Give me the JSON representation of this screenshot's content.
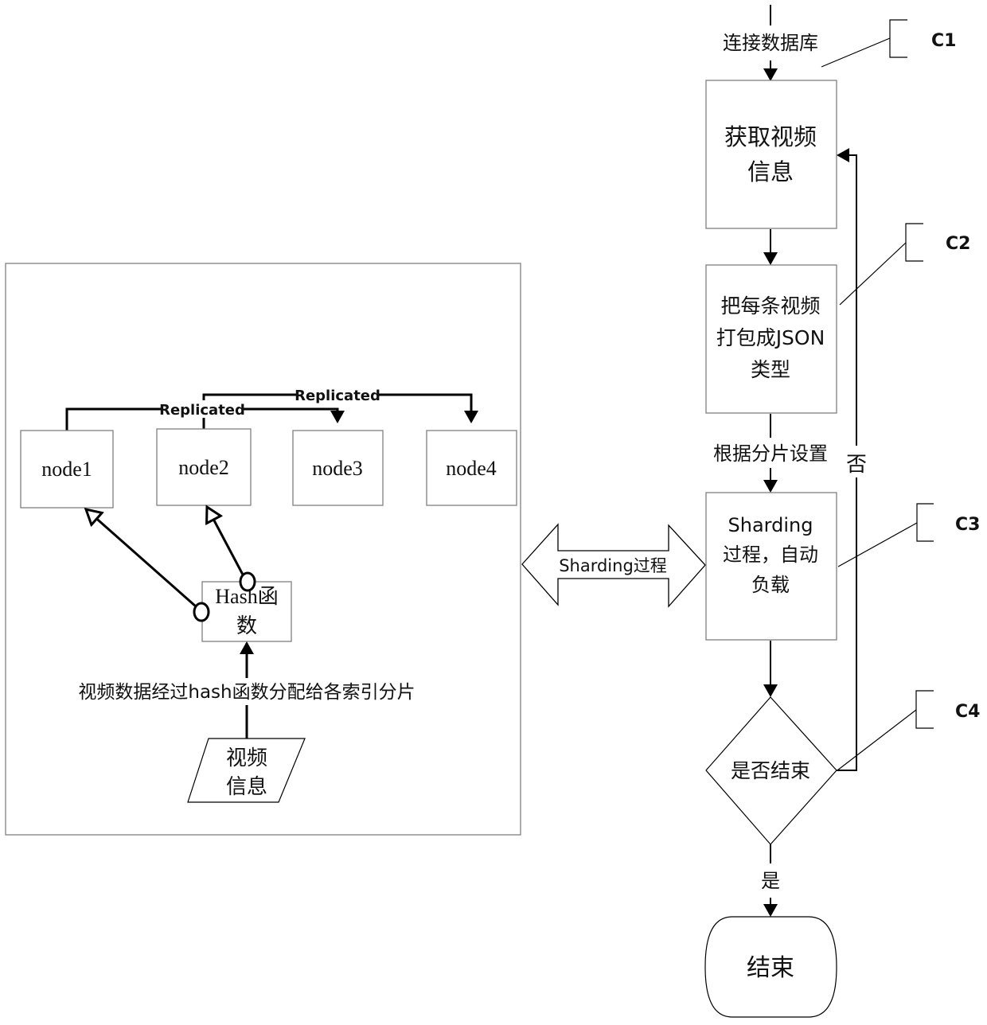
{
  "left_panel": {
    "nodes": [
      "node1",
      "node2",
      "node3",
      "node4"
    ],
    "replicated_labels": [
      "Replicated",
      "Replicated"
    ],
    "hash_box": {
      "line1": "Hash函",
      "line2": "数"
    },
    "distribution_label": "视频数据经过hash函数分配给各索引分片",
    "input": {
      "line1": "视频",
      "line2": "信息"
    }
  },
  "connector": {
    "label": "Sharding过程"
  },
  "flowchart": {
    "start_label": "连接数据库",
    "steps": [
      {
        "id": "C1",
        "lines": [
          "获取视频",
          "信息"
        ]
      },
      {
        "id": "C2",
        "lines": [
          "把每条视频",
          "打包成JSON",
          "类型"
        ]
      },
      {
        "id": "C3",
        "lines": [
          "Sharding",
          "过程，自动",
          "负载"
        ]
      }
    ],
    "shard_setting_label": "根据分片设置",
    "decision": {
      "id": "C4",
      "label": "是否结束"
    },
    "no_label": "否",
    "yes_label": "是",
    "end_label": "结束"
  },
  "callouts": [
    "C1",
    "C2",
    "C3",
    "C4"
  ]
}
